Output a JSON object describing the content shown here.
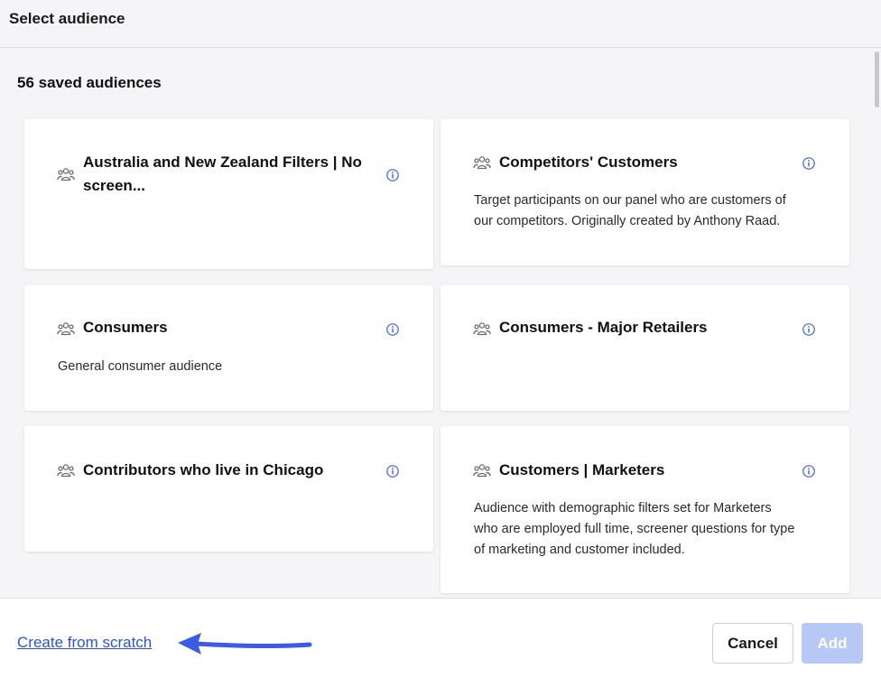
{
  "header": {
    "title": "Select audience"
  },
  "main": {
    "count_label": "56 saved audiences",
    "cards": [
      {
        "title_line1": "Australia and New Zealand Filters | No",
        "title_line2": "screen...",
        "description": ""
      },
      {
        "title": "Competitors' Customers",
        "desc_line1": "Target participants on our panel who are customers of",
        "desc_line2": "our competitors. Originally created by Anthony Raad."
      },
      {
        "title": "Consumers",
        "description": "General consumer audience"
      },
      {
        "title": "Consumers - Major Retailers",
        "description": ""
      },
      {
        "title": "Contributors who live in Chicago",
        "description": ""
      },
      {
        "title": "Customers | Marketers",
        "desc_line1": "Audience with demographic filters set for Marketers",
        "desc_line2": "who are employed full time, screener questions for type",
        "desc_line3": "of marketing and customer included."
      }
    ]
  },
  "footer": {
    "create_link": "Create from scratch",
    "cancel_label": "Cancel",
    "add_label": "Add"
  },
  "icons": {
    "audience": "people-group-icon",
    "info": "info-icon",
    "annotation": "arrow-left-icon"
  },
  "colors": {
    "link": "#2c55d6",
    "add_disabled": "#b8c8f6",
    "info_icon": "#3b5fd9",
    "arrow": "#3a5be6"
  }
}
